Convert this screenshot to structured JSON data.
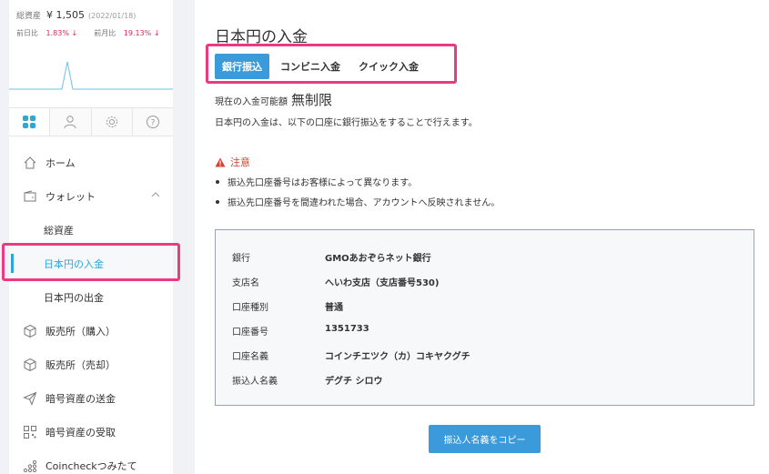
{
  "sidebar": {
    "assets": {
      "label": "総資産",
      "value": "¥ 1,505",
      "date": "(2022/01/18)",
      "day_label": "前日比",
      "day_change": "1.83% ↓",
      "month_label": "前月比",
      "month_change": "19.13% ↓"
    },
    "icon_tabs": [
      "grid-icon",
      "user-icon",
      "gear-icon",
      "help-icon"
    ],
    "nav": {
      "home": "ホーム",
      "wallet": "ウォレット",
      "total_assets": "総資産",
      "jpy_deposit": "日本円の入金",
      "jpy_withdraw": "日本円の出金",
      "buy": "販売所（購入）",
      "sell": "販売所（売却）",
      "send": "暗号資産の送金",
      "receive": "暗号資産の受取",
      "tsumitate": "Coincheckつみたて"
    }
  },
  "main": {
    "title": "日本円の入金",
    "tabs": {
      "bank": "銀行振込",
      "convenience": "コンビニ入金",
      "quick": "クイック入金"
    },
    "limit_label": "現在の入金可能額",
    "limit_value": "無制限",
    "description": "日本円の入金は、以下の口座に銀行振込をすることで行えます。",
    "caution_title": "注意",
    "caution_items": [
      "振込先口座番号はお客様によって異なります。",
      "振込先口座番号を間違われた場合、アカウントへ反映されません。"
    ],
    "bank_info": {
      "bank_label": "銀行",
      "bank_value": "GMOあおぞらネット銀行",
      "branch_label": "支店名",
      "branch_value": "へいわ支店（支店番号530)",
      "type_label": "口座種別",
      "type_value": "普通",
      "number_label": "口座番号",
      "number_value": "1351733",
      "name_label": "口座名義",
      "name_value": "コインチエツク（カ）コキヤクグチ",
      "payer_label": "振込人名義",
      "payer_value": "デグチ シロウ"
    },
    "copy_button": "振込人名義をコピー"
  },
  "colors": {
    "accent": "#3b9ad9",
    "highlight": "#ec3a82",
    "negative": "#e0245e",
    "caution": "#d9412e"
  }
}
